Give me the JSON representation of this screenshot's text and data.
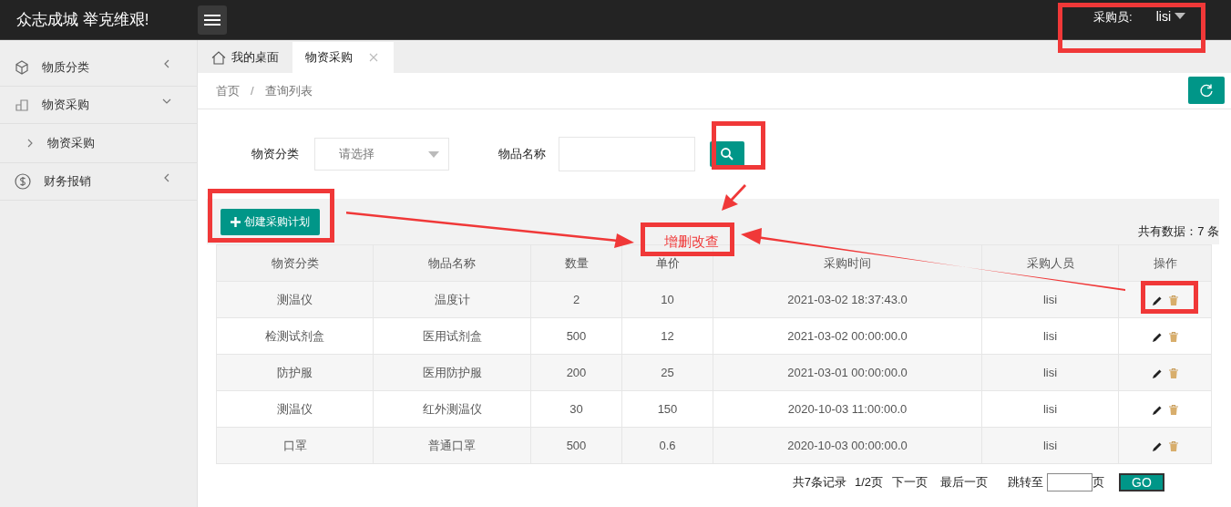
{
  "header": {
    "title": "众志成城 举克维艰!",
    "user_label": "采购员:",
    "user_name": "lisi"
  },
  "sidebar": {
    "items": [
      {
        "label": "物质分类",
        "expanded": false
      },
      {
        "label": "物资采购",
        "expanded": true,
        "children": [
          {
            "label": "物资采购"
          }
        ]
      },
      {
        "label": "财务报销",
        "expanded": false
      }
    ]
  },
  "tabs": [
    {
      "label": "我的桌面",
      "selected": false,
      "closable": false
    },
    {
      "label": "物资采购",
      "selected": true,
      "closable": true
    }
  ],
  "breadcrumb": [
    "首页",
    "查询列表"
  ],
  "breadcrumb_separator": "/",
  "filters": {
    "category_label": "物资分类",
    "category_placeholder": "请选择",
    "name_label": "物品名称"
  },
  "toolbar": {
    "create_button": "创建采购计划",
    "count_text": "共有数据：7 条"
  },
  "table": {
    "columns": [
      "物资分类",
      "物品名称",
      "数量",
      "单价",
      "采购时间",
      "采购人员",
      "操作"
    ],
    "rows": [
      [
        "测温仪",
        "温度计",
        "2",
        "10",
        "2021-03-02 18:37:43.0",
        "lisi"
      ],
      [
        "检测试剂盒",
        "医用试剂盒",
        "500",
        "12",
        "2021-03-02 00:00:00.0",
        "lisi"
      ],
      [
        "防护服",
        "医用防护服",
        "200",
        "25",
        "2021-03-01 00:00:00.0",
        "lisi"
      ],
      [
        "测温仪",
        "红外测温仪",
        "30",
        "150",
        "2020-10-03 11:00:00.0",
        "lisi"
      ],
      [
        "口罩",
        "普通口罩",
        "500",
        "0.6",
        "2020-10-03 00:00:00.0",
        "lisi"
      ]
    ]
  },
  "pagination": {
    "total": "共7条记录",
    "page": "1/2页",
    "next": "下一页",
    "last": "最后一页",
    "jump_label": "跳转至",
    "jump_suffix": "页",
    "go": "GO"
  },
  "annotation": {
    "label": "增删改查"
  }
}
